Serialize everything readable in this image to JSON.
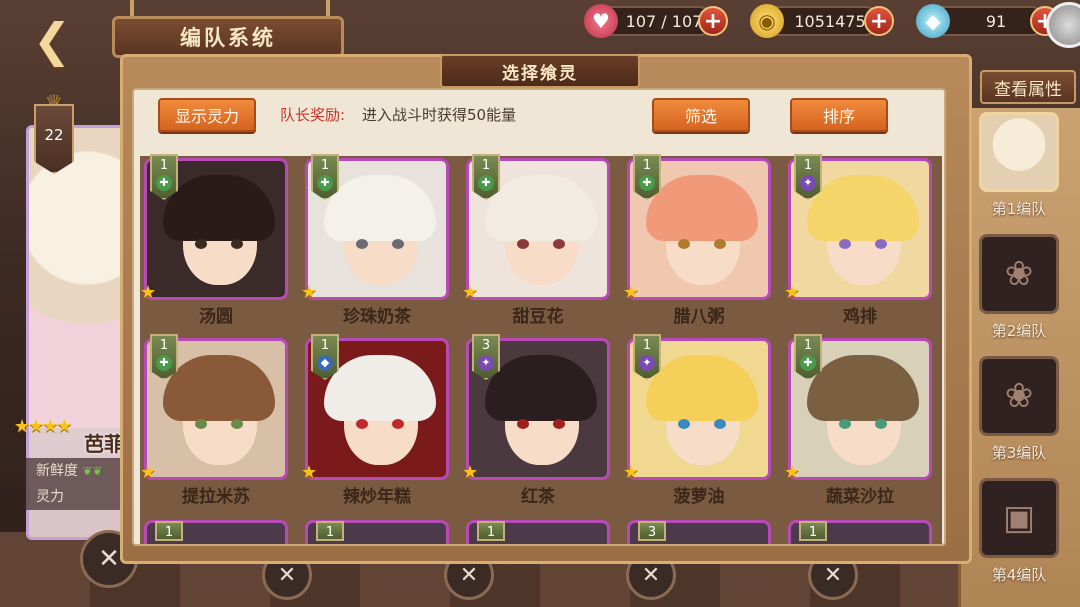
{
  "header": {
    "title": "编队系统",
    "back_icon": "back-arrow-icon"
  },
  "resources": {
    "stamina": {
      "value": "107 / 107",
      "icon": "heart-icon"
    },
    "gold": {
      "value": "1051475",
      "icon": "gold-coin-icon"
    },
    "gem": {
      "value": "91",
      "icon": "crystal-icon"
    },
    "plus_label": "+"
  },
  "panel": {
    "title": "选择飨灵",
    "show_power_button": "显示灵力",
    "captain_reward_label": "队长奖励:",
    "captain_reward_text": "进入战斗时获得50能量",
    "filter_button": "筛选",
    "sort_button": "排序"
  },
  "characters": [
    {
      "name": "汤圆",
      "level": "1",
      "type": "plus",
      "bg": "#3a2a2a",
      "hair": "#2a1a18",
      "eye": "#3a2a20"
    },
    {
      "name": "珍珠奶茶",
      "level": "1",
      "type": "plus",
      "bg": "#e8e2dc",
      "hair": "#f4f0ea",
      "eye": "#6a6a70"
    },
    {
      "name": "甜豆花",
      "level": "1",
      "type": "plus",
      "bg": "#efe4dc",
      "hair": "#f2ebe2",
      "eye": "#8a3a3a"
    },
    {
      "name": "腊八粥",
      "level": "1",
      "type": "plus",
      "bg": "#f0c8b0",
      "hair": "#f19a7a",
      "eye": "#b07a30"
    },
    {
      "name": "鸡排",
      "level": "1",
      "type": "star",
      "bg": "#f0d8a0",
      "hair": "#f5d56a",
      "eye": "#8a6ac0"
    },
    {
      "name": "提拉米苏",
      "level": "1",
      "type": "plus",
      "bg": "#d8c0a8",
      "hair": "#8a5a38",
      "eye": "#6a8a4a"
    },
    {
      "name": "辣炒年糕",
      "level": "1",
      "type": "shield",
      "bg": "#7a1a1a",
      "hair": "#f0ece8",
      "eye": "#c02a2a"
    },
    {
      "name": "红茶",
      "level": "3",
      "type": "star",
      "bg": "#4a3a40",
      "hair": "#2a1e20",
      "eye": "#a02020"
    },
    {
      "name": "菠萝油",
      "level": "1",
      "type": "star",
      "bg": "#f0d890",
      "hair": "#f5cf5a",
      "eye": "#3a8ac0"
    },
    {
      "name": "蔬菜沙拉",
      "level": "1",
      "type": "plus",
      "bg": "#d8d0b8",
      "hair": "#7a6040",
      "eye": "#4a9a7a"
    }
  ],
  "partial_row": [
    {
      "level": "1"
    },
    {
      "level": "1"
    },
    {
      "level": "1"
    },
    {
      "level": "3"
    },
    {
      "level": "1"
    }
  ],
  "left_card": {
    "level": "22",
    "stars": "★★★★",
    "name": "芭菲",
    "freshness_label": "新鲜度",
    "power_label": "灵力",
    "leaves": "❦❦"
  },
  "sidebar": {
    "view_attr_button": "查看属性",
    "teams": [
      {
        "label": "第1编队",
        "active": true
      },
      {
        "label": "第2编队",
        "active": false
      },
      {
        "label": "第3编队",
        "active": false
      },
      {
        "label": "第4编队",
        "active": false
      }
    ]
  }
}
